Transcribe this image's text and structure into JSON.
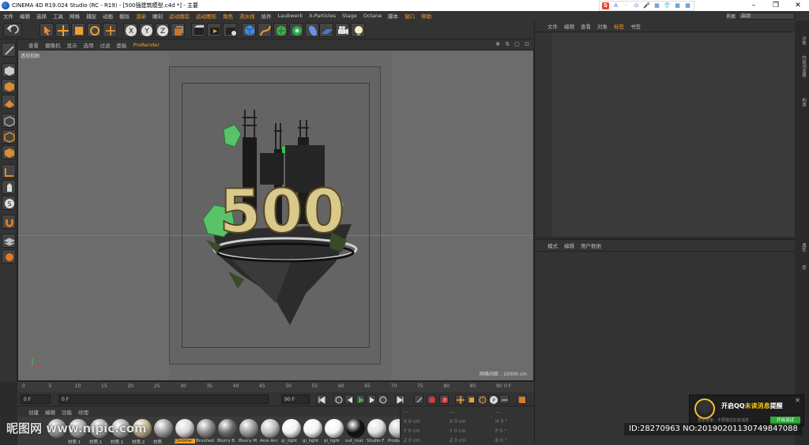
{
  "window": {
    "title": "CINEMA 4D R19.024 Studio (RC - R19) - [500强建筑模型.c4d *] - 主要",
    "controls": [
      "–",
      "❐",
      "✕"
    ]
  },
  "ime_toolbar": {
    "items": [
      "S",
      "A",
      "·",
      "⊙",
      "🎤",
      "▦",
      "👕",
      "▦",
      "▦"
    ]
  },
  "menubar": {
    "items": [
      "文件",
      "编辑",
      "选择",
      "工具",
      "网格",
      "捕捉",
      "动画",
      "模拟",
      "渲染",
      "雕刻",
      "运动跟踪",
      "运动图形",
      "角色",
      "流水线",
      "插件",
      "Laubwerk",
      "X-Particles",
      "Stage",
      "Octane",
      "脚本",
      "窗口",
      "帮助"
    ],
    "highlight_index": [
      8,
      10,
      11,
      12,
      13,
      20,
      21
    ]
  },
  "layout": {
    "label": "界面",
    "value": "启动"
  },
  "viewport_menu": {
    "items": [
      "查看",
      "摄像机",
      "显示",
      "选项",
      "过滤",
      "面板"
    ],
    "prorender": "ProRender",
    "controls": "✥ ⇅ ▢ ⊡"
  },
  "viewport": {
    "camera_label": "透视视图",
    "grid_info": "网格间距 : 10000 cm",
    "scene_text": "500"
  },
  "timeline": {
    "ticks": [
      "0",
      "5",
      "10",
      "15",
      "20",
      "25",
      "30",
      "35",
      "40",
      "45",
      "50",
      "55",
      "60",
      "65",
      "70",
      "75",
      "80",
      "85",
      "90"
    ],
    "frame_indicator": "0 F"
  },
  "playbar": {
    "current_frame": "0 F",
    "start_field": "0 F",
    "end_field": "90 F",
    "end_field2": "90 F"
  },
  "material_menu": {
    "items": [
      "创建",
      "编辑",
      "功能",
      "纹理"
    ]
  },
  "materials": [
    {
      "label": "",
      "color": "#9b9b9b"
    },
    {
      "label": "材质.1",
      "color": "#a7a7a7"
    },
    {
      "label": "材质.1",
      "color": "#b0b0b0"
    },
    {
      "label": "材质.1",
      "color": "#a8a8a8"
    },
    {
      "label": "材质.2",
      "color": "#c4b48a"
    },
    {
      "label": "材质",
      "color": "#9c9c9c"
    },
    {
      "label": "Chrome",
      "color": "#d8d8d8",
      "selected": true
    },
    {
      "label": "Brushed",
      "color": "#8b8b8b"
    },
    {
      "label": "Blurry B",
      "color": "#6c6c6c"
    },
    {
      "label": "Blurry M",
      "color": "#9a9a9a"
    },
    {
      "label": "Anis Ani",
      "color": "#bdbdbd"
    },
    {
      "label": "gi_light",
      "color": "#f2f2f2"
    },
    {
      "label": "gi_light",
      "color": "#f4f4f4"
    },
    {
      "label": "gi_light",
      "color": "#f5f5f5"
    },
    {
      "label": "out_mat",
      "color": "#111111"
    },
    {
      "label": "Studio F",
      "color": "#e0e0e0"
    },
    {
      "label": "Product",
      "color": "#c9c9c9"
    }
  ],
  "coords": {
    "header": [
      "---",
      "---",
      "---"
    ],
    "rows": [
      [
        "X  0 cm",
        "X  0 cm",
        "H  0 °"
      ],
      [
        "Y  0 cm",
        "Y  0 cm",
        "P  0 °"
      ],
      [
        "Z  0 cm",
        "Z  0 cm",
        "B  0 °"
      ]
    ]
  },
  "object_panel": {
    "menu": [
      "文件",
      "编辑",
      "查看",
      "对象",
      "标签",
      "书签"
    ],
    "active_index": 4
  },
  "attribute_panel": {
    "menu": [
      "模式",
      "编辑",
      "用户数据"
    ]
  },
  "side_tabs": [
    "对象",
    "内容浏览器",
    "构造",
    "属性",
    "层"
  ],
  "qq_popup": {
    "title_prefix": "开启QQ",
    "title_highlight": "未读消息",
    "title_suffix": "提醒",
    "subtitle": "登录管家，不再错过好友消息",
    "button": "开启试试",
    "close": "✕"
  },
  "watermark": {
    "site": "昵图网 www.nipic.com",
    "id": "ID:28270963 NO:20190201130749847088"
  },
  "colors": {
    "accent": "#f0a030",
    "panel": "#333333",
    "viewport": "#686868"
  }
}
